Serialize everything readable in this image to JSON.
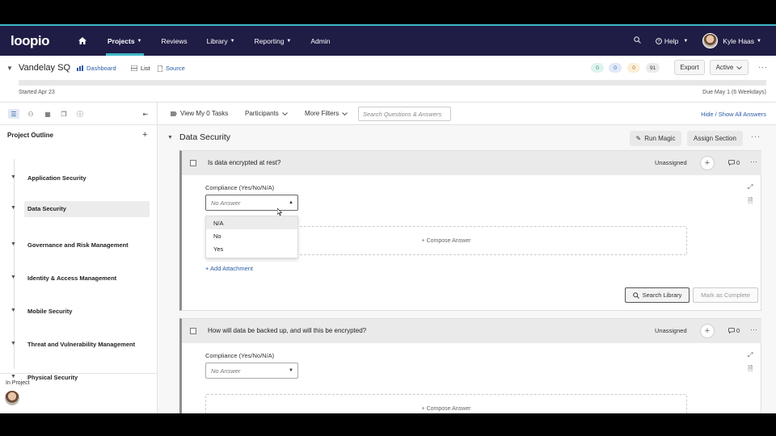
{
  "nav": {
    "logo": "loopio",
    "items": [
      {
        "label": "Projects",
        "active": true,
        "caret": true
      },
      {
        "label": "Reviews",
        "active": false,
        "caret": false
      },
      {
        "label": "Library",
        "active": false,
        "caret": true
      },
      {
        "label": "Reporting",
        "active": false,
        "caret": true
      },
      {
        "label": "Admin",
        "active": false,
        "caret": false
      }
    ],
    "help": "Help",
    "user": "Kyle Haas",
    "accent": "#3fb8c8",
    "bg": "#1f1c45"
  },
  "project": {
    "title": "Vandelay SQ",
    "dashboard": "Dashboard",
    "list": "List",
    "source": "Source",
    "badges": [
      "0",
      "0",
      "0",
      "91"
    ],
    "export": "Export",
    "status": "Active",
    "started": "Started Apr 23",
    "due": "Due May 1 (6 Weekdays)"
  },
  "sidebar": {
    "heading": "Project Outline",
    "items": [
      "Application Security",
      "Data Security",
      "Governance and Risk Management",
      "Identity & Access Management",
      "Mobile Security",
      "Threat and Vulnerability Management",
      "Physical Security"
    ],
    "selected": "Data Security",
    "in_project": "In Project"
  },
  "filters": {
    "view_tasks": "View My 0 Tasks",
    "participants": "Participants",
    "more_filters": "More Filters",
    "search_placeholder": "Search Questions & Answers",
    "hide_show": "Hide / Show All Answers"
  },
  "section": {
    "title": "Data Security",
    "run_magic": "Run Magic",
    "assign": "Assign Section"
  },
  "questions": [
    {
      "text": "Is data encrypted at rest?",
      "assignee": "Unassigned",
      "comments": "0",
      "compliance_label": "Compliance (Yes/No/N/A)",
      "select_placeholder": "No Answer",
      "compose": "+ Compose Answer",
      "add_attachment": "+ Add Attachment",
      "search_library": "Search Library",
      "mark_complete": "Mark as Complete"
    },
    {
      "text": "How will data be backed up, and will this be encrypted?",
      "assignee": "Unassigned",
      "comments": "0",
      "compliance_label": "Compliance (Yes/No/N/A)",
      "select_placeholder": "No Answer",
      "compose": "+ Compose Answer"
    }
  ],
  "dropdown": {
    "options": [
      "N/A",
      "No",
      "Yes"
    ],
    "hovered": "N/A"
  }
}
